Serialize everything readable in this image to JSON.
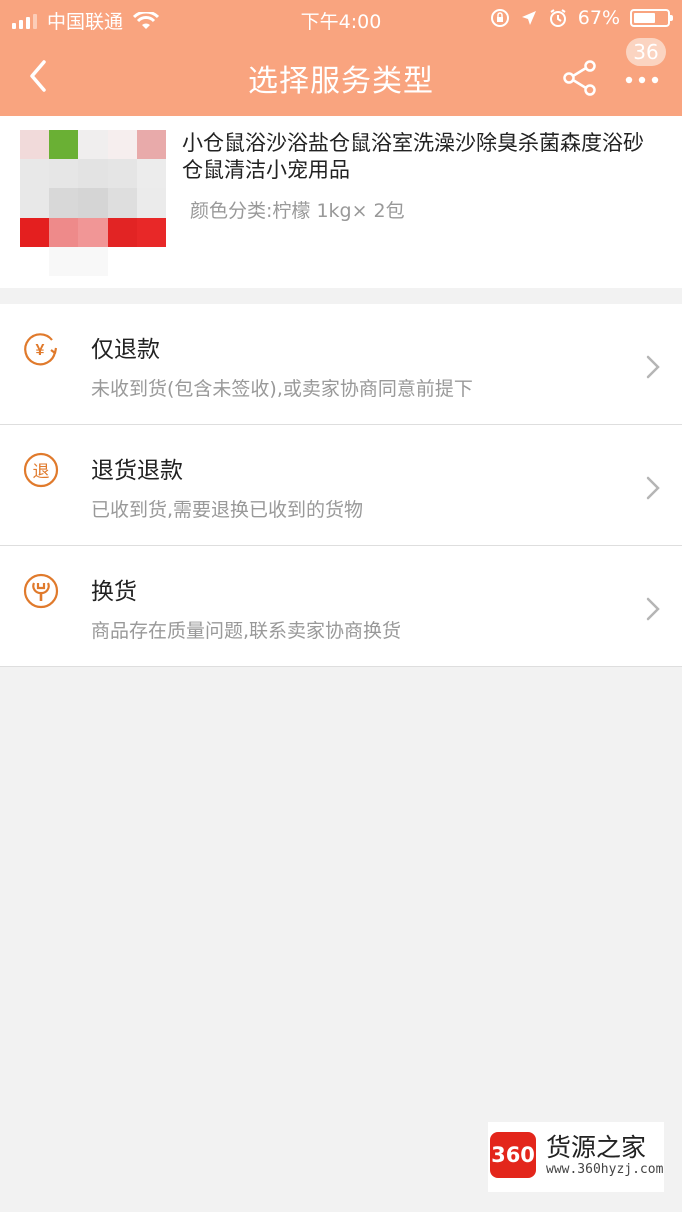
{
  "status_bar": {
    "carrier": "中国联通",
    "time": "下午4:00",
    "battery_percent": "67%",
    "battery_level": 0.67,
    "icons": [
      "signal-icon",
      "wifi-icon",
      "orientation-lock-icon",
      "location-icon",
      "alarm-icon",
      "battery-icon"
    ]
  },
  "nav": {
    "title": "选择服务类型",
    "badge_count": "36",
    "icons": [
      "back-icon",
      "share-icon",
      "more-icon"
    ]
  },
  "product": {
    "title": "小仓鼠浴沙浴盐仓鼠浴室洗澡沙除臭杀菌森度浴砂仓鼠清洁小宠用品",
    "spec": "颜色分类:柠檬 1kg× 2包"
  },
  "options": [
    {
      "title": "仅退款",
      "desc": "未收到货(包含未签收),或卖家协商同意前提下",
      "icon": "refund-only-icon"
    },
    {
      "title": "退货退款",
      "desc": "已收到货,需要退换已收到的货物",
      "icon": "return-refund-icon"
    },
    {
      "title": "换货",
      "desc": "商品存在质量问题,联系卖家协商换货",
      "icon": "exchange-icon"
    }
  ],
  "watermark": {
    "mark": "360",
    "name": "货源之家",
    "url": "www.360hyzj.com"
  },
  "colors": {
    "header": "#f9a47f",
    "accent": "#e07a2c",
    "background": "#f2f2f2",
    "watermark_red": "#e3261b"
  }
}
